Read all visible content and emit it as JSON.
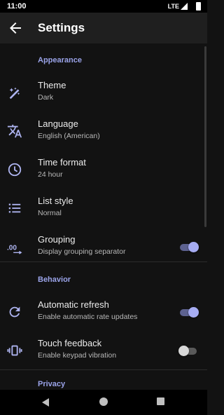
{
  "status_bar": {
    "time": "11:00",
    "network": "LTE"
  },
  "app_bar": {
    "title": "Settings"
  },
  "sections": {
    "appearance": "Appearance",
    "behavior": "Behavior",
    "privacy": "Privacy"
  },
  "settings": {
    "theme": {
      "label": "Theme",
      "summary": "Dark",
      "icon": "theme-icon"
    },
    "language": {
      "label": "Language",
      "summary": "English (American)",
      "icon": "translate-icon"
    },
    "time_format": {
      "label": "Time format",
      "summary": "24 hour",
      "icon": "clock-icon"
    },
    "list_style": {
      "label": "List style",
      "summary": "Normal",
      "icon": "list-icon"
    },
    "grouping": {
      "label": "Grouping",
      "summary": "Display grouping separator",
      "icon": "decimal-icon",
      "enabled": true
    },
    "automatic_refresh": {
      "label": "Automatic refresh",
      "summary": "Enable automatic rate updates",
      "icon": "refresh-icon",
      "enabled": true
    },
    "touch_feedback": {
      "label": "Touch feedback",
      "summary": "Enable keypad vibration",
      "icon": "vibration-icon",
      "enabled": false
    }
  },
  "colors": {
    "accent": "#9aa3e8",
    "background": "#121212",
    "app_bar": "#1f1f1f"
  }
}
